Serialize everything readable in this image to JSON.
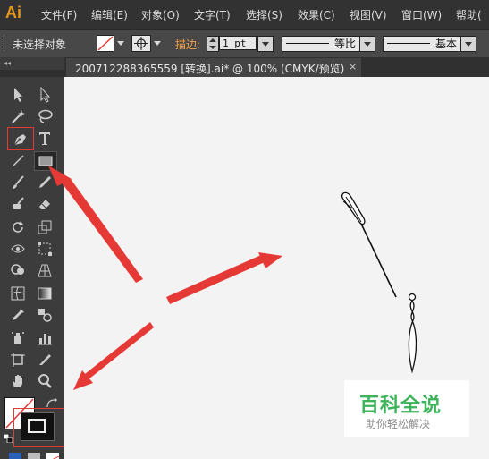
{
  "app": {
    "logo": "Ai"
  },
  "menu": [
    "文件(F)",
    "编辑(E)",
    "对象(O)",
    "文字(T)",
    "选择(S)",
    "效果(C)",
    "视图(V)",
    "窗口(W)",
    "帮助("
  ],
  "control_bar": {
    "selection_status": "未选择对象",
    "stroke_label": "描边:",
    "stroke_weight": "1 pt",
    "profile_label": "等比",
    "brush_label": "基本"
  },
  "document_tab": {
    "title": "200712288365559 [转换].ai* @ 100% (CMYK/预览)",
    "close": "×"
  },
  "toolbox": {
    "collapse_glyph": "◂◂",
    "tools": [
      "selection-tool",
      "direct-selection-tool",
      "magic-wand-tool",
      "lasso-tool",
      "pen-tool",
      "type-tool",
      "line-segment-tool",
      "rectangle-tool",
      "paintbrush-tool",
      "pencil-tool",
      "blob-brush-tool",
      "eraser-tool",
      "rotate-tool",
      "scale-tool",
      "width-tool",
      "free-transform-tool",
      "shape-builder-tool",
      "perspective-grid-tool",
      "mesh-tool",
      "gradient-tool",
      "eyedropper-tool",
      "blend-tool",
      "symbol-sprayer-tool",
      "column-graph-tool",
      "artboard-tool",
      "slice-tool",
      "hand-tool",
      "zoom-tool"
    ]
  },
  "watermark": {
    "title": "百科全说",
    "subtitle": "助你轻松解决"
  },
  "colors": {
    "accent": "#e8951a",
    "highlight": "#e53935",
    "watermark_green": "#3db35a"
  }
}
